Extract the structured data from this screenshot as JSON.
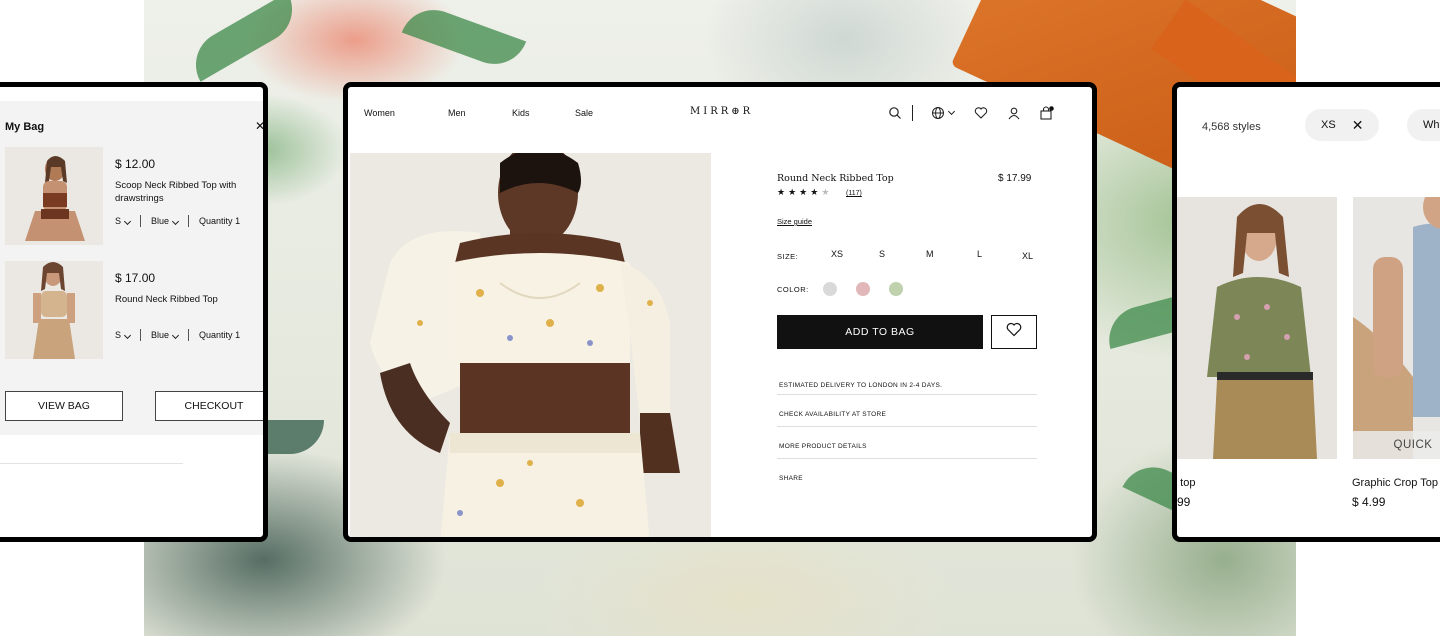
{
  "bag": {
    "title": "My Bag",
    "close_icon": "close-icon",
    "items": [
      {
        "price": "$ 12.00",
        "name": "Scoop Neck Ribbed Top with drawstrings",
        "size": "S",
        "color": "Blue",
        "quantity_label": "Quantity",
        "quantity": "1"
      },
      {
        "price": "$ 17.00",
        "name": "Round Neck Ribbed Top",
        "size": "S",
        "color": "Blue",
        "quantity_label": "Quantity",
        "quantity": "1"
      }
    ],
    "view_bag_label": "VIEW BAG",
    "checkout_label": "CHECKOUT"
  },
  "pdp": {
    "nav": [
      "Women",
      "Men",
      "Kids",
      "Sale"
    ],
    "logo": "MIRR⊕R",
    "icons": [
      "search-icon",
      "globe-icon",
      "heart-icon",
      "user-icon",
      "bag-icon"
    ],
    "product": {
      "title": "Round Neck Ribbed Top",
      "price": "$ 17.99",
      "rating": 4,
      "rating_max": 5,
      "reviews": "(117)",
      "size_guide": "Size guide",
      "size_label": "SIZE:",
      "sizes": [
        "XS",
        "S",
        "M",
        "L",
        "XL"
      ],
      "color_label": "COLOR:",
      "colors": [
        "#d9d9d9",
        "#e2b7b9",
        "#bfd1ad"
      ],
      "add_to_bag": "ADD TO BAG",
      "info": [
        "ESTIMATED DELIVERY TO LONDON IN 2-4 DAYS.",
        "CHECK AVAILABILITY AT STORE",
        "MORE PRODUCT DETAILS",
        "SHARE"
      ]
    }
  },
  "plp": {
    "styles_count": "4,568 styles",
    "filters": [
      {
        "label": "XS"
      },
      {
        "label": "Wh"
      }
    ],
    "products": [
      {
        "name": "e top",
        "price": "99"
      },
      {
        "name": "Graphic Crop Top",
        "price": "$ 4.99",
        "quick_label": "QUICK"
      }
    ]
  },
  "colors": {
    "accent": "#111111",
    "panel": "#f3f3f3"
  }
}
